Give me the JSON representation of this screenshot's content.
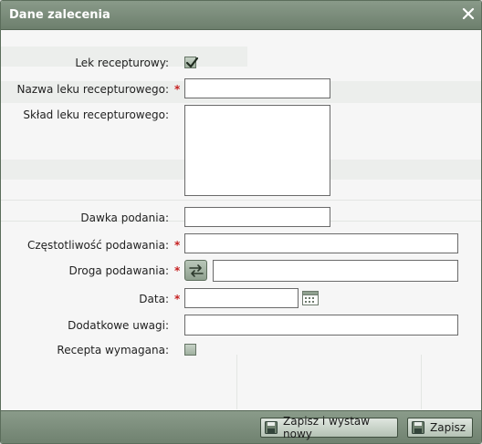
{
  "dialog": {
    "title": "Dane zalecenia"
  },
  "form": {
    "compounded_label": "Lek recepturowy:",
    "compounded_checked": true,
    "name_label": "Nazwa leku recepturowego:",
    "name_value": "",
    "composition_label": "Skład leku recepturowego:",
    "composition_value": "",
    "dose_label": "Dawka podania:",
    "dose_value": "",
    "frequency_label": "Częstotliwość podawania:",
    "frequency_value": "",
    "route_label": "Droga podawania:",
    "route_value": "",
    "date_label": "Data:",
    "date_value": "",
    "notes_label": "Dodatkowe uwagi:",
    "notes_value": "",
    "prescription_label": "Recepta wymagana:",
    "prescription_checked": false,
    "required_marker": "*"
  },
  "footer": {
    "save_and_issue_label": "Zapisz i wystaw nowy",
    "save_label": "Zapisz"
  },
  "icons": {
    "close": "close-icon",
    "swap": "swap-arrows-icon",
    "calendar": "calendar-icon",
    "save": "floppy-disk-icon"
  },
  "colors": {
    "title_bar": "#7d8f7d",
    "required": "#c62020",
    "button_bg": "#c9d3c9"
  }
}
